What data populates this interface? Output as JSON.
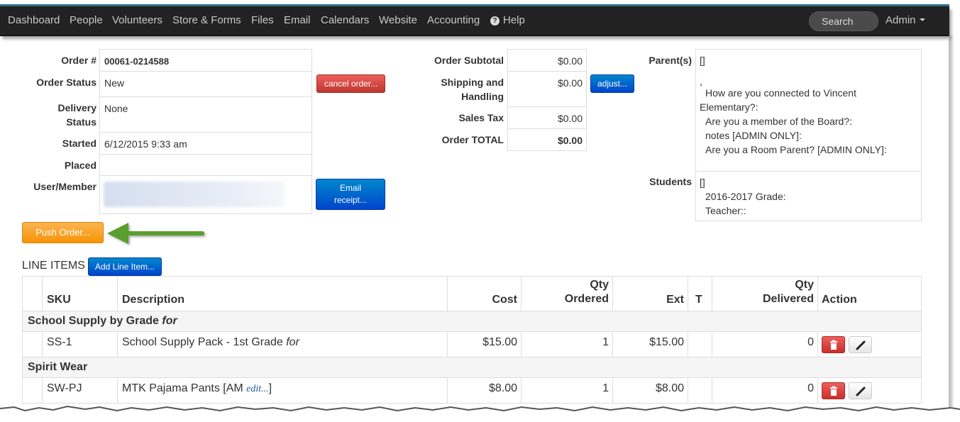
{
  "nav": {
    "items": [
      "Dashboard",
      "People",
      "Volunteers",
      "Store & Forms",
      "Files",
      "Email",
      "Calendars",
      "Website",
      "Accounting"
    ],
    "help": "Help",
    "search_placeholder": "Search",
    "admin": "Admin"
  },
  "order": {
    "order_number_label": "Order #",
    "order_number": "00061-0214588",
    "status_label": "Order Status",
    "status": "New",
    "delivery_label": "Delivery Status",
    "delivery": "None",
    "started_label": "Started",
    "started": "6/12/2015 9:33 am",
    "placed_label": "Placed",
    "placed": "",
    "user_label": "User/Member",
    "cancel_button": "cancel order...",
    "email_button_line1": "Email",
    "email_button_line2": "receipt..."
  },
  "totals": {
    "subtotal_label": "Order Subtotal",
    "subtotal": "$0.00",
    "shipping_label_line1": "Shipping and",
    "shipping_label_line2": "Handling",
    "shipping": "$0.00",
    "tax_label": "Sales Tax",
    "tax": "$0.00",
    "total_label": "Order TOTAL",
    "total": "$0.00",
    "adjust_button": "adjust..."
  },
  "parents": {
    "label": "Parent(s)",
    "brackets": "[]",
    "comma": ",",
    "q1": "How are you connected to Vincent",
    "q1b": "Elementary?:",
    "q2": "Are you a member of the Board?:",
    "q3": "notes [ADMIN ONLY]:",
    "q4": "Are you a Room Parent? [ADMIN ONLY]:"
  },
  "students": {
    "label": "Students",
    "brackets": "[]",
    "grade": "2016-2017 Grade:",
    "teacher": "Teacher::"
  },
  "push_button": "Push Order...",
  "line_items": {
    "title": "LINE ITEMS",
    "add_button": "Add Line Item...",
    "headers": {
      "sku": "SKU",
      "description": "Description",
      "cost": "Cost",
      "qty_ordered_1": "Qty",
      "qty_ordered_2": "Ordered",
      "ext": "Ext",
      "t": "T",
      "qty_delivered_1": "Qty",
      "qty_delivered_2": "Delivered",
      "action": "Action"
    },
    "groups": [
      {
        "name": "School Supply by Grade",
        "name_suffix": "for",
        "rows": [
          {
            "sku": "SS-1",
            "description": "School Supply Pack - 1st Grade",
            "desc_suffix": "for",
            "cost": "$15.00",
            "qty": "1",
            "ext": "$15.00",
            "t": "",
            "delivered": "0"
          }
        ]
      },
      {
        "name": "Spirit Wear",
        "name_suffix": "",
        "rows": [
          {
            "sku": "SW-PJ",
            "description": "MTK Pajama Pants [AM",
            "desc_link": "edit...",
            "desc_close": "]",
            "cost": "$8.00",
            "qty": "1",
            "ext": "$8.00",
            "t": "",
            "delivered": "0"
          }
        ]
      }
    ]
  },
  "colors": {
    "navbar": "#222222",
    "accent_line": "#2c6f8e",
    "danger": "#d9534f",
    "primary": "#0066cc",
    "warning": "#f89406",
    "arrow": "#5a9e2f"
  }
}
